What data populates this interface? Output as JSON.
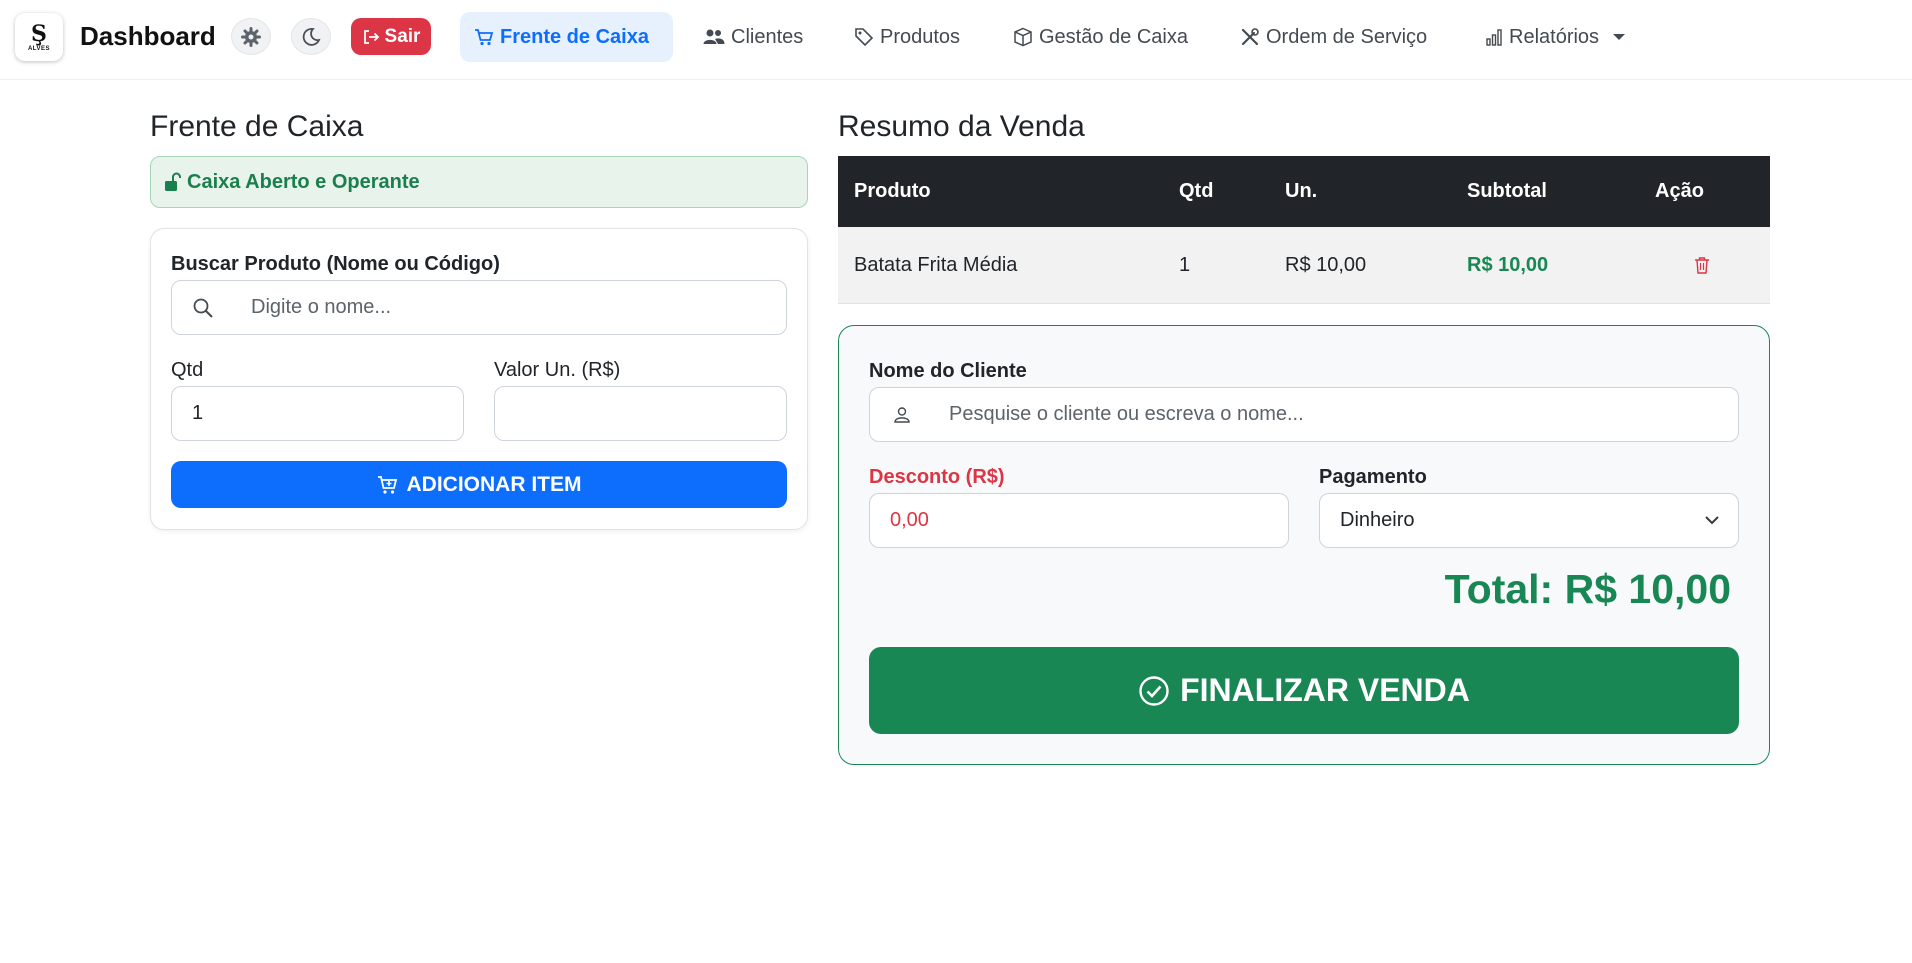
{
  "brand": {
    "title": "Dashboard",
    "logo_text": "ALVES"
  },
  "header": {
    "logout_label": "Sair"
  },
  "nav": {
    "items": [
      {
        "label": "Frente de Caixa",
        "icon": "cart-icon",
        "active": true
      },
      {
        "label": "Clientes",
        "icon": "people-icon"
      },
      {
        "label": "Produtos",
        "icon": "tag-icon"
      },
      {
        "label": "Gestão de Caixa",
        "icon": "box-icon"
      },
      {
        "label": "Ordem de Serviço",
        "icon": "tools-icon"
      },
      {
        "label": "Relatórios",
        "icon": "bar-chart-icon"
      }
    ]
  },
  "left": {
    "title": "Frente de Caixa",
    "status": "Caixa Aberto e Operante",
    "search_label": "Buscar Produto (Nome ou Código)",
    "search_placeholder": "Digite o nome...",
    "qty_label": "Qtd",
    "qty_value": "1",
    "unit_label": "Valor Un. (R$)",
    "unit_value": "",
    "add_button": "ADICIONAR ITEM"
  },
  "summary": {
    "title": "Resumo da Venda",
    "columns": [
      "Produto",
      "Qtd",
      "Un.",
      "Subtotal",
      "Ação"
    ],
    "rows": [
      {
        "product": "Batata Frita Média",
        "qty": "1",
        "unit": "R$ 10,00",
        "subtotal": "R$ 10,00"
      }
    ]
  },
  "checkout": {
    "client_label": "Nome do Cliente",
    "client_placeholder": "Pesquise o cliente ou escreva o nome...",
    "discount_label": "Desconto (R$)",
    "discount_value": "0,00",
    "payment_label": "Pagamento",
    "payment_value": "Dinheiro",
    "total": "Total: R$ 10,00",
    "finalize_button": "FINALIZAR VENDA"
  },
  "colors": {
    "primary": "#0d6efd",
    "success": "#198754",
    "danger": "#dc3545",
    "dark": "#212529"
  }
}
